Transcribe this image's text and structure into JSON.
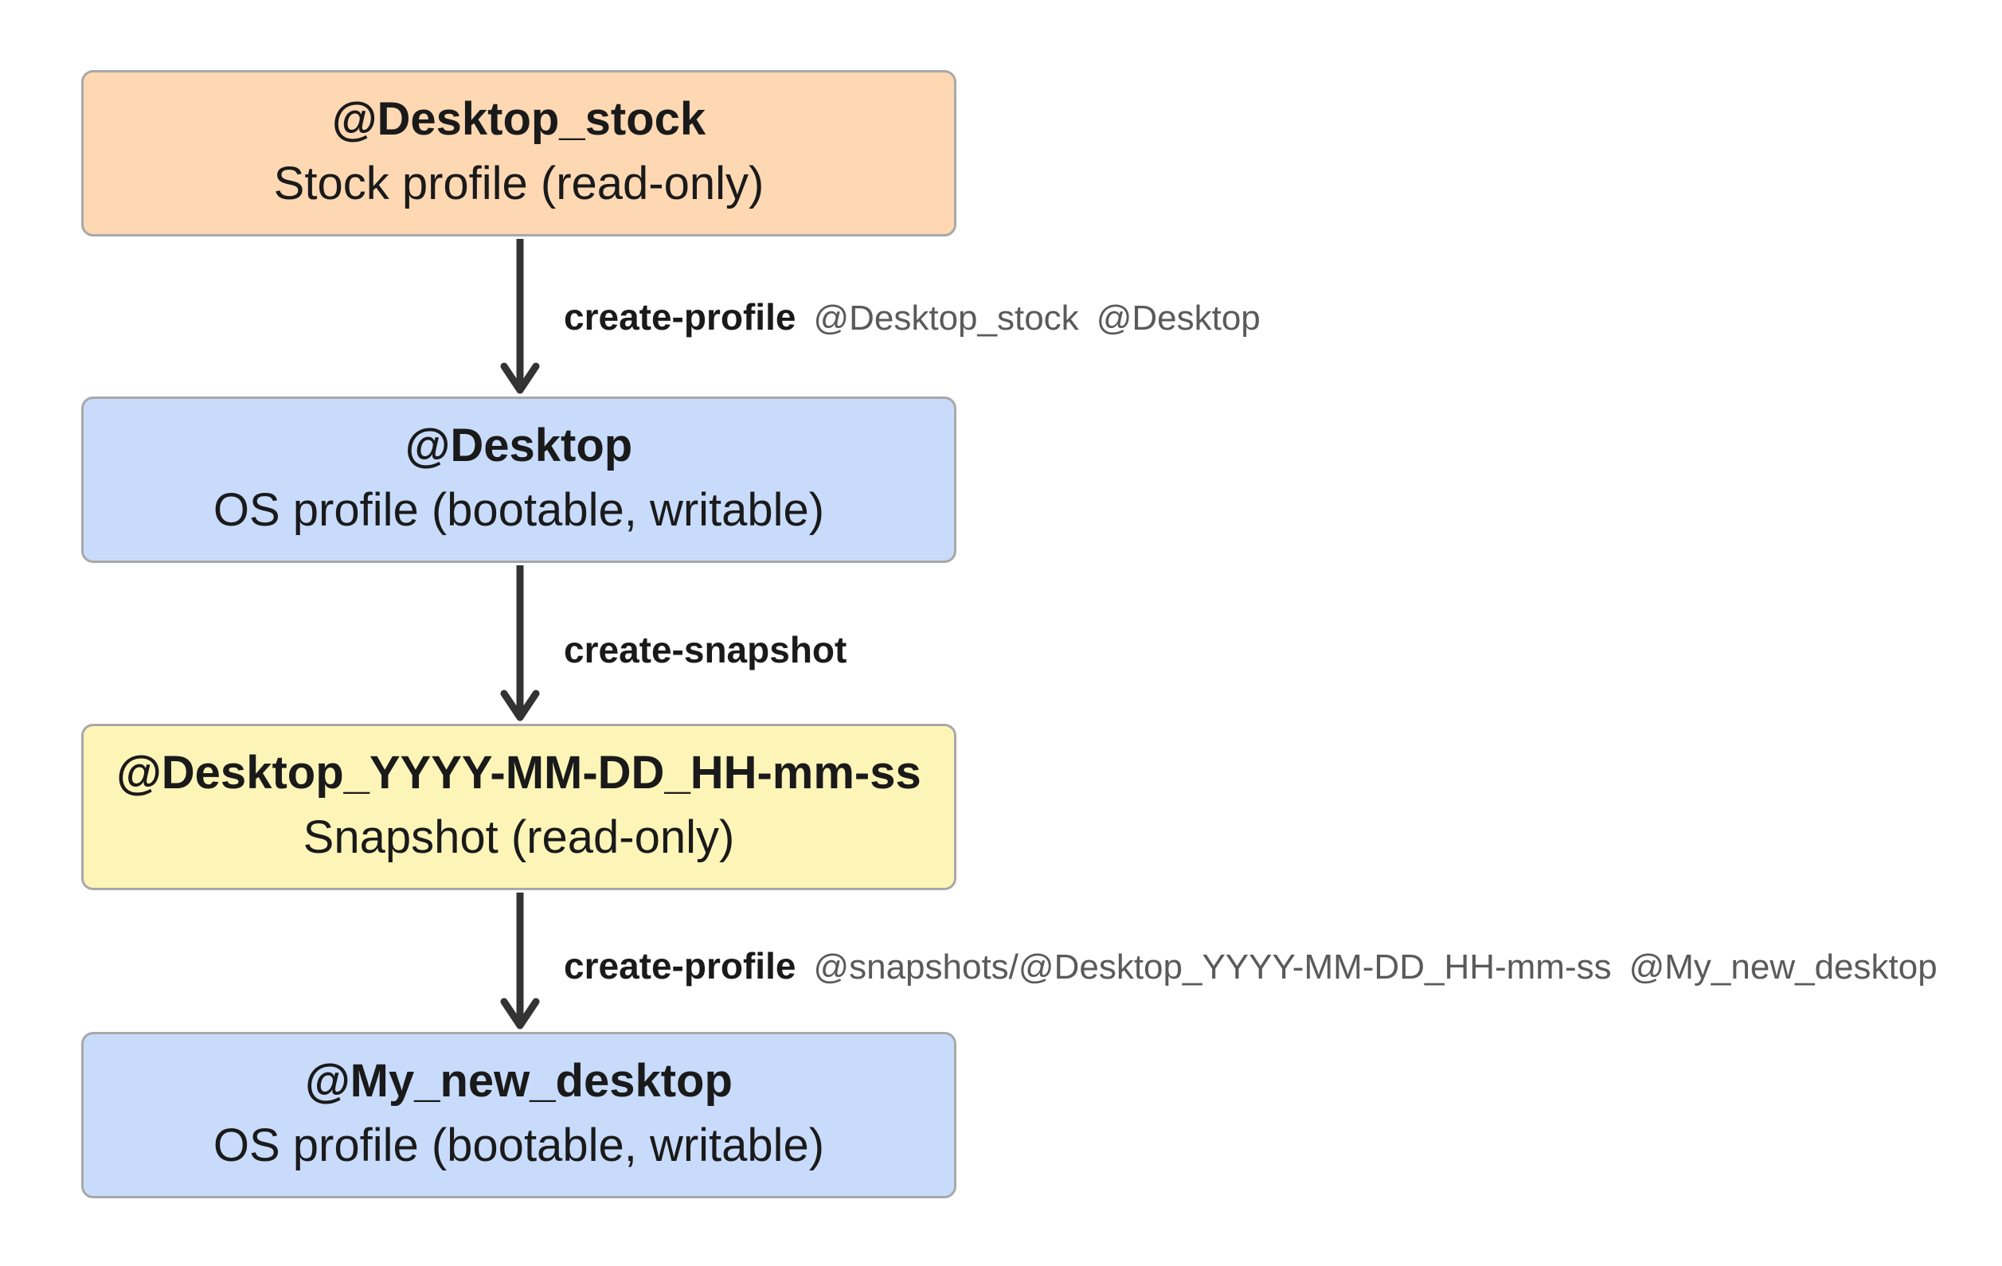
{
  "nodes": [
    {
      "title": "@Desktop_stock",
      "subtitle": "Stock profile (read-only)",
      "fill": "#fdd8b3"
    },
    {
      "title": "@Desktop",
      "subtitle": "OS profile (bootable, writable)",
      "fill": "#c8dbfb"
    },
    {
      "title": "@Desktop_YYYY-MM-DD_HH-mm-ss",
      "subtitle": "Snapshot (read-only)",
      "fill": "#fdf5b8"
    },
    {
      "title": "@My_new_desktop",
      "subtitle": "OS profile (bootable, writable)",
      "fill": "#c8dbfb"
    }
  ],
  "edges": [
    {
      "from": 0,
      "to": 1,
      "command": "create-profile",
      "args": [
        "@Desktop_stock",
        "@Desktop"
      ]
    },
    {
      "from": 1,
      "to": 2,
      "command": "create-snapshot",
      "args": []
    },
    {
      "from": 2,
      "to": 3,
      "command": "create-profile",
      "args": [
        "@snapshots/@Desktop_YYYY-MM-DD_HH-mm-ss",
        "@My_new_desktop"
      ]
    }
  ],
  "colors": {
    "arrow": "#333333",
    "node_border": "#a8a8a8"
  }
}
